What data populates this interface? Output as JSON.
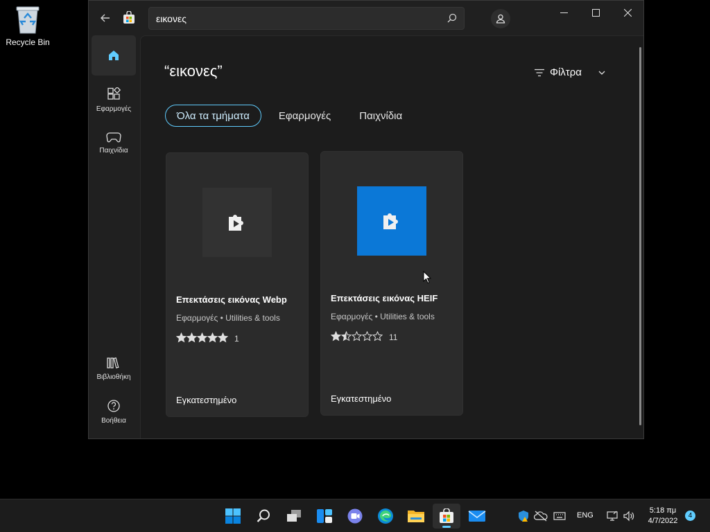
{
  "desktop": {
    "recycle_bin_label": "Recycle Bin"
  },
  "store": {
    "search": {
      "value": "εικονες"
    },
    "nav": {
      "home": "",
      "apps": "Εφαρμογές",
      "games": "Παιχνίδια",
      "library": "Βιβλιοθήκη",
      "help": "Βοήθεια"
    },
    "results": {
      "query_title": "“εικονες”",
      "filters_label": "Φίλτρα",
      "pills": [
        "Όλα τα τμήματα",
        "Εφαρμογές",
        "Παιχνίδια"
      ],
      "active_pill": 0
    },
    "cards": [
      {
        "title": "Επεκτάσεις εικόνας Webp",
        "category": "Εφαρμογές",
        "subcategory": "Utilities & tools",
        "meta": "Εφαρμογές • Utilities & tools",
        "rating": 5,
        "rating_count": "1",
        "status": "Εγκατεστημένο",
        "icon": "puzzle-video-icon",
        "icon_bg": "#323232"
      },
      {
        "title": "Επεκτάσεις εικόνας HEIF",
        "category": "Εφαρμογές",
        "subcategory": "Utilities & tools",
        "meta": "Εφαρμογές • Utilities & tools",
        "rating": 1.5,
        "rating_count": "11",
        "status": "Εγκατεστημένο",
        "icon": "puzzle-video-icon",
        "icon_bg": "#0b78d7"
      }
    ]
  },
  "taskbar": {
    "apps": [
      "start-icon",
      "search-icon",
      "task-view-icon",
      "widgets-icon",
      "teams-chat-icon",
      "edge-icon",
      "file-explorer-icon",
      "store-icon",
      "mail-icon"
    ],
    "active_app": "store-icon",
    "language": "ENG",
    "time": "5:18 πμ",
    "date": "4/7/2022",
    "notification_count": "4"
  },
  "colors": {
    "accent": "#60cdff",
    "store_blue": "#0b78d7",
    "background": "#202020"
  }
}
